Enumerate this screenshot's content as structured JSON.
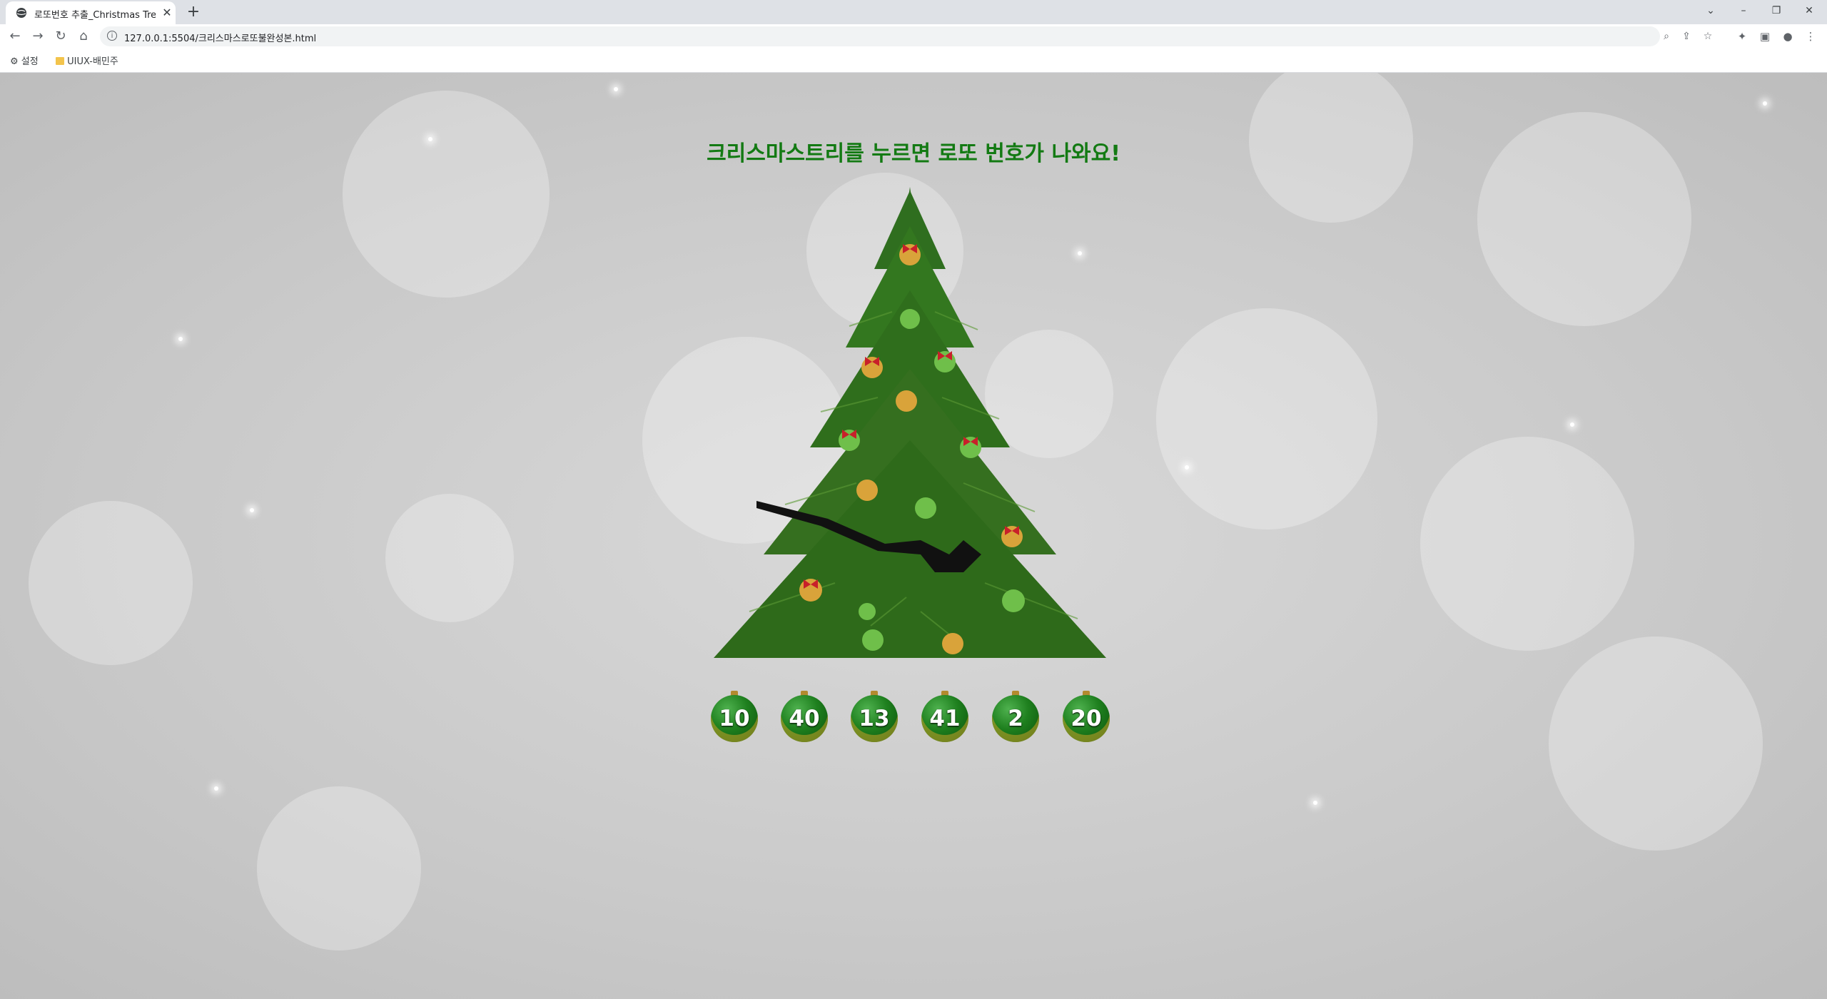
{
  "browser": {
    "tab_title": "로또번호 추출_Christmas Tree.w",
    "url": "127.0.0.1:5504/크리스마스로또불완성본.html",
    "bookmarks": [
      {
        "label": "설정",
        "icon": "gear-icon"
      },
      {
        "label": "UIUX-배민주",
        "icon": "folder-icon"
      }
    ]
  },
  "page": {
    "headline": "크리스마스트리를 누르면 로또 번호가 나와요!",
    "lotto_numbers": [
      "10",
      "40",
      "13",
      "41",
      "2",
      "20"
    ],
    "colors": {
      "headline": "#137a13",
      "ball": "#1e7f1e",
      "background": "#c9c9c9"
    }
  }
}
